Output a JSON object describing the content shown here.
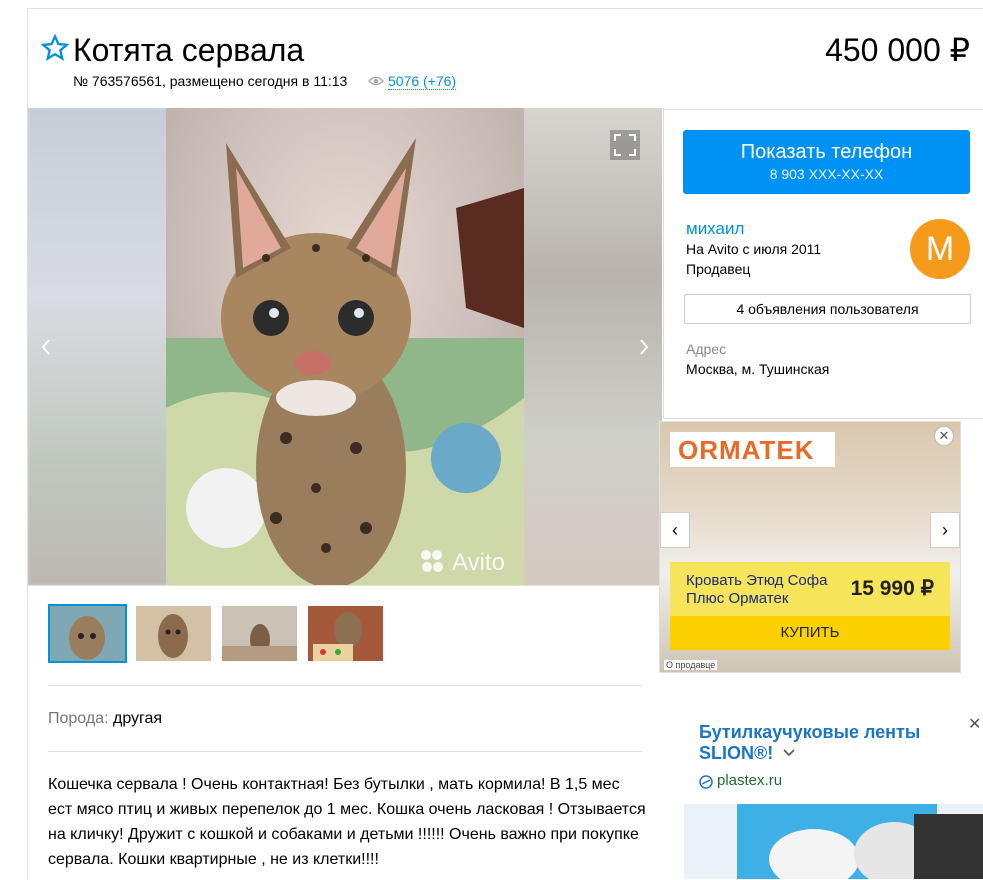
{
  "listing": {
    "title": "Котята сервала",
    "price": "450 000 ₽",
    "meta": "№ 763576561, размещено сегодня в 11:13",
    "views": "5076 (+76)",
    "gallery_watermark": "Avito"
  },
  "thumbnails": [
    "photo-1",
    "photo-2",
    "photo-3",
    "photo-4"
  ],
  "params": {
    "breed_label": "Порода:",
    "breed_value": "другая"
  },
  "description": "Кошечка сервала ! Очень контактная! Без бутылки , мать кормила! В 1,5 мес ест мясо птиц и живых перепелок до 1 мес. Кошка очень ласковая ! Отзывается на кличку! Дружит с кошкой и собаками и детьми !!!!!! Очень важно при покупке сервала. Кошки квартирные , не из клетки!!!!",
  "contact": {
    "button_label": "Показать телефон",
    "phone_masked": "8 903 XXX-XX-XX",
    "seller_name": "михаил",
    "since": "На Avito с июля 2011",
    "role": "Продавец",
    "avatar_letter": "M",
    "ads_button": "4 объявления пользователя",
    "address_label": "Адрес",
    "address": "Москва, м. Тушинская"
  },
  "ad_ormatek": {
    "brand": "ORMATEK",
    "product": "Кровать Этюд Софа Плюс Орматек",
    "price": "15 990 ₽",
    "buy": "КУПИТЬ",
    "about": "О продавце"
  },
  "ad_slion": {
    "title": "Бутилкаучуковые ленты SLION®!",
    "domain": "plastex.ru"
  },
  "colors": {
    "accent": "#0091f5",
    "link": "#0091d9",
    "avatar": "#f59a1b",
    "buy": "#fdd000"
  },
  "icons": [
    "star-icon",
    "eye-icon",
    "fullscreen-icon",
    "chevron-left-icon",
    "chevron-right-icon",
    "close-icon",
    "chevron-down-icon"
  ]
}
